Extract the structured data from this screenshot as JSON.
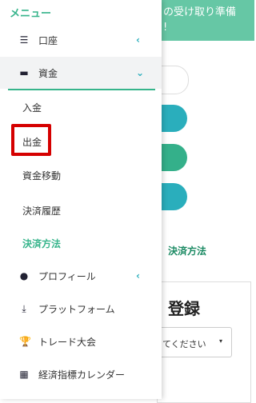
{
  "background": {
    "banner_line1": "の受け取り準備",
    "banner_line2": "!",
    "payment_method_label": "決済方法",
    "card_title": "登録",
    "select_placeholder": "てください",
    "select_caret": "▾"
  },
  "menu": {
    "title": "メニュー",
    "items": [
      {
        "label": "口座",
        "icon": "list-icon",
        "glyph": "☰",
        "chevron": "‹"
      },
      {
        "label": "資金",
        "icon": "wallet-icon",
        "glyph": "▬",
        "chevron": "⌄"
      },
      {
        "label": "入金"
      },
      {
        "label": "出金"
      },
      {
        "label": "資金移動"
      },
      {
        "label": "決済履歴"
      },
      {
        "label": "決済方法"
      },
      {
        "label": "プロフィール",
        "icon": "user-icon",
        "glyph": "●",
        "chevron": "‹"
      },
      {
        "label": "プラットフォーム",
        "icon": "download-icon",
        "glyph": "⤓"
      },
      {
        "label": "トレード大会",
        "icon": "trophy-icon",
        "glyph": "🏆"
      },
      {
        "label": "経済指標カレンダー",
        "icon": "calendar-icon",
        "glyph": "▦"
      }
    ]
  },
  "colors": {
    "accent_green": "#36b48b",
    "chevron_teal": "#2aaebc",
    "highlight_red": "#d50000"
  }
}
